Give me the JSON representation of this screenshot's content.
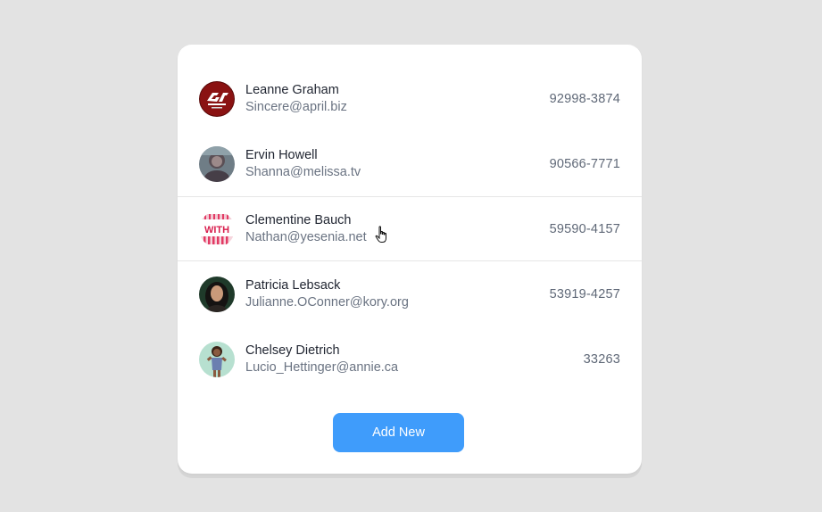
{
  "contacts": [
    {
      "name": "Leanne Graham",
      "email": "Sincere@april.biz",
      "phone": "92998-3874",
      "avatar_icon": "gt-sport-logo-icon"
    },
    {
      "name": "Ervin Howell",
      "email": "Shanna@melissa.tv",
      "phone": "90566-7771",
      "avatar_icon": "user-photo-icon"
    },
    {
      "name": "Clementine Bauch",
      "email": "Nathan@yesenia.net",
      "phone": "59590-4157",
      "avatar_icon": "with-logo-icon"
    },
    {
      "name": "Patricia Lebsack",
      "email": "Julianne.OConner@kory.org",
      "phone": "53919-4257",
      "avatar_icon": "user-photo-icon"
    },
    {
      "name": "Chelsey Dietrich",
      "email": "Lucio_Hettinger@annie.ca",
      "phone": "33263",
      "avatar_icon": "user-photo-icon"
    }
  ],
  "add_button": {
    "label": "Add New"
  },
  "avatar_text": {
    "with": "WITH"
  },
  "colors": {
    "background": "#e3e3e3",
    "card": "#ffffff",
    "accent": "#3f9cfb",
    "name_text": "#1f2430",
    "secondary_text": "#6a7382"
  }
}
